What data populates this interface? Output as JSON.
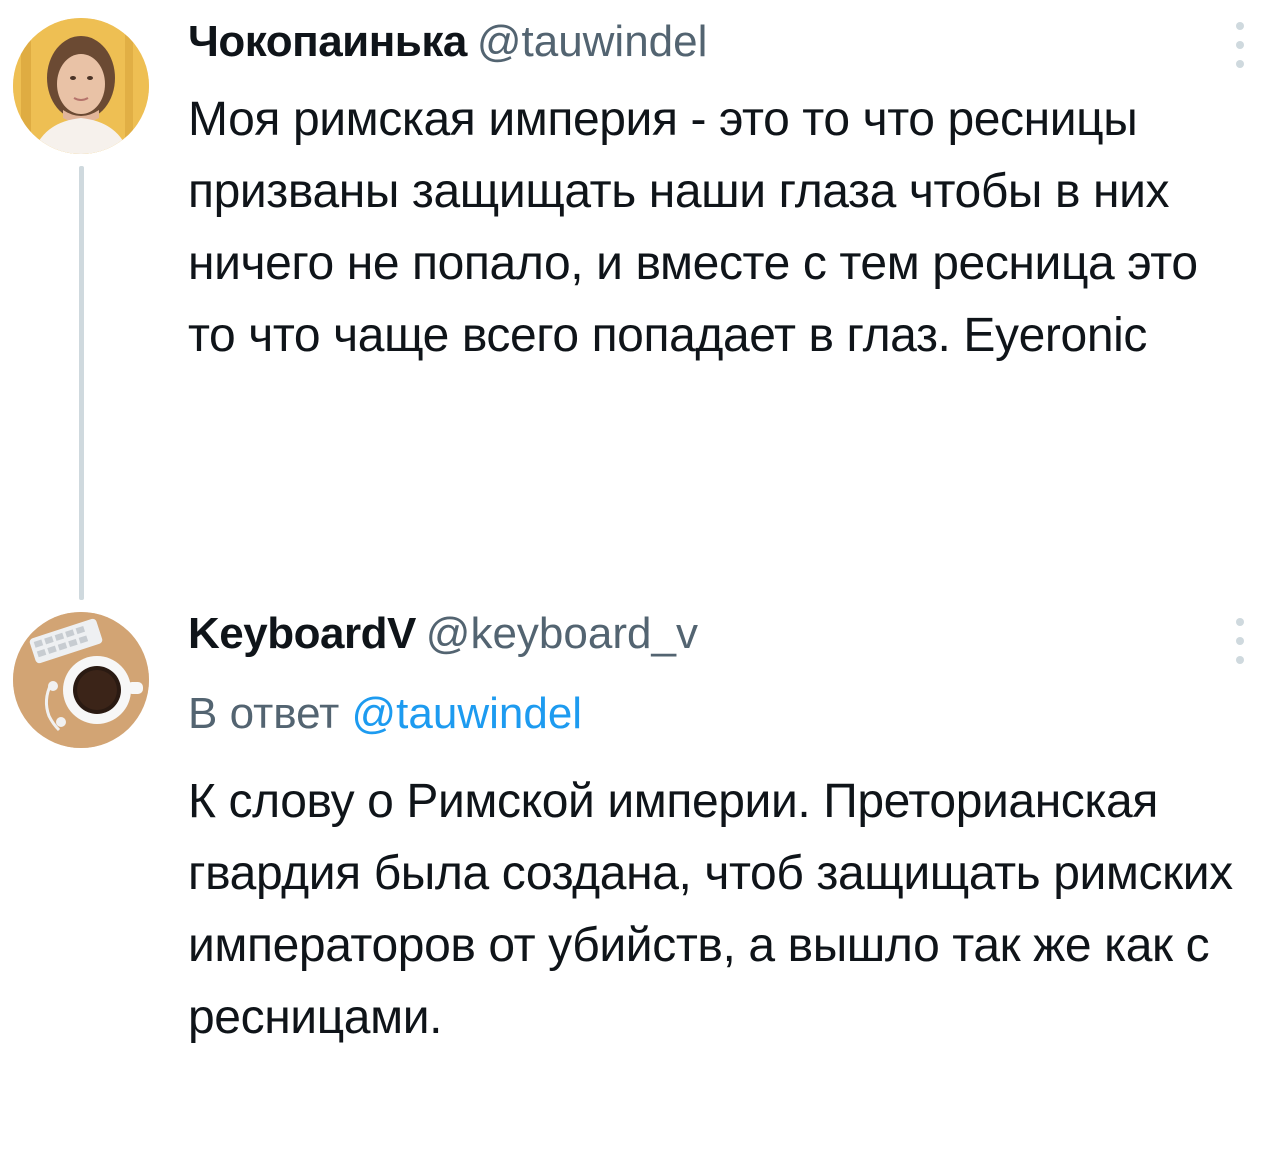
{
  "tweets": [
    {
      "display_name": "Чокопаинька",
      "handle": "@tauwindel",
      "text": "Моя римская империя - это то что ресницы призваны защищать наши глаза чтобы в них ничего не попало, и вместе с тем ресница это то что чаще всего попадает в глаз. Eyeronic",
      "avatar_icon": "user-avatar-photo",
      "more_icon": "more-vertical-icon"
    },
    {
      "display_name": "KeyboardV",
      "handle": "@keyboard_v",
      "reply_prefix": "В ответ",
      "reply_to": "@tauwindel",
      "text": "К слову о Римской империи. Преторианская гвардия была создана, чтоб защищать римских императоров от убийств, а вышло так же как с ресницами.",
      "avatar_icon": "coffee-cup-avatar",
      "more_icon": "more-vertical-icon"
    }
  ],
  "colors": {
    "text_primary": "#0f1419",
    "text_secondary": "#536471",
    "link": "#1d9bf0",
    "thread_line": "#cfd9de"
  }
}
